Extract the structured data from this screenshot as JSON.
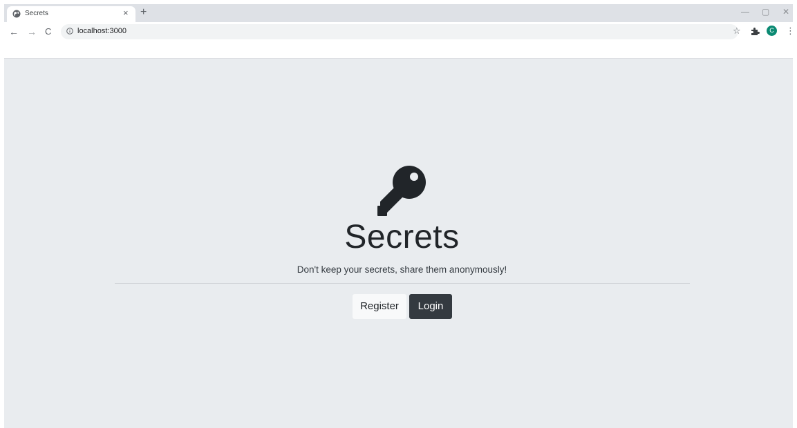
{
  "browser": {
    "tab": {
      "title": "Secrets",
      "close_glyph": "×",
      "favicon": "globe-icon"
    },
    "new_tab_glyph": "+",
    "window_controls": {
      "minimize": "—",
      "restore": "▢",
      "close": "✕"
    },
    "toolbar": {
      "back": "←",
      "forward": "→",
      "reload": "C",
      "url": "localhost:3000",
      "bookmark_star": "☆",
      "extensions_icon": "puzzle-icon",
      "profile_initial": "C",
      "menu": "⋮"
    }
  },
  "page": {
    "icon": "key-icon",
    "title": "Secrets",
    "lead": "Don't keep your secrets, share them anonymously!",
    "buttons": {
      "register": "Register",
      "login": "Login"
    }
  },
  "colors": {
    "page_background": "#e9ecef",
    "login_button": "#343a40",
    "register_button": "#f8f9fa",
    "profile_avatar": "#0b8a73"
  }
}
